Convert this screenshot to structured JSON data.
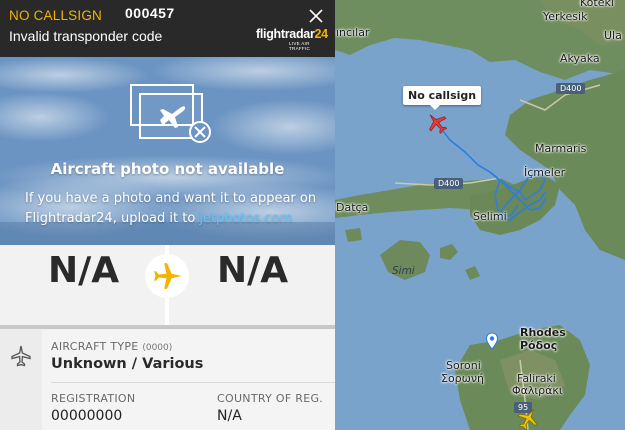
{
  "header": {
    "callsign": "NO CALLSIGN",
    "hex_code": "000457",
    "status": "Invalid transponder code",
    "logo_text": "flightradar",
    "logo_number": "24",
    "logo_sub": "LIVE AIR TRAFFIC"
  },
  "photo": {
    "title": "Aircraft photo not available",
    "message": "If you have a photo and want it to appear on Flightradar24, upload it to ",
    "link": "jetphotos.com"
  },
  "route": {
    "origin": "N/A",
    "destination": "N/A"
  },
  "details": {
    "aircraft_type_label": "AIRCRAFT TYPE",
    "aircraft_type_code": "(0000)",
    "aircraft_type_value": "Unknown / Various",
    "registration_label": "REGISTRATION",
    "registration_value": "00000000",
    "country_label": "COUNTRY OF REG.",
    "country_value": "N/A"
  },
  "map": {
    "callout": "No callsign",
    "labels": {
      "cinarcik": "ıncılar",
      "yerkesik": "Yerkesik",
      "koteki": "Koteki",
      "ula": "Ula",
      "akyaka": "Akyaka",
      "marmaris": "Marmaris",
      "icmeler": "İçmeler",
      "datca": "Datça",
      "selimiye": "Selimi",
      "simi": "Simi",
      "rhodes": "Rhodes",
      "rodos": "Ρόδος",
      "soroni": "Soroni",
      "soroni_gr": "Σορωνή",
      "faliraki": "Faliraki",
      "faliraki_gr": "Φαλιράκι"
    },
    "road_shields": {
      "d400_north": "D400",
      "d400_west": "D400",
      "route_95": "95"
    }
  },
  "colors": {
    "callsign_accent": "#f2b400",
    "header_bg": "#292929",
    "sea": "#7aa3cc",
    "land": "#6b8a5c",
    "track": "#2e7de0",
    "aircraft_selected": "#e23b3b",
    "aircraft_other": "#f2c300",
    "link": "#5fc7ff"
  }
}
